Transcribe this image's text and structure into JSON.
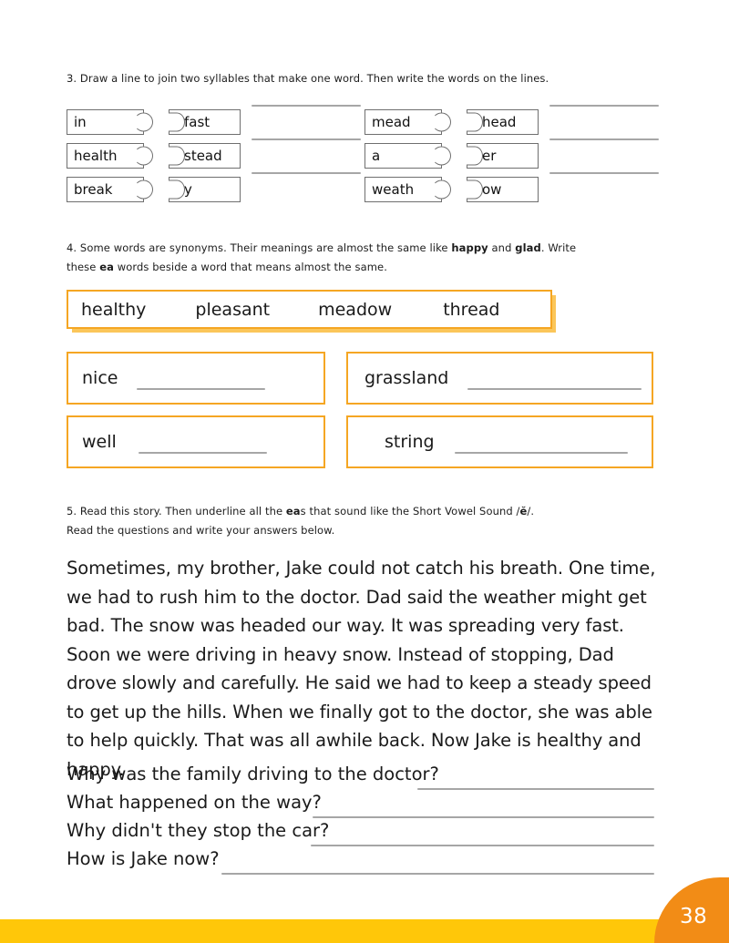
{
  "page": {
    "number": "38",
    "accent_orange": "#F5A623",
    "badge_orange": "#F28C16",
    "footer_yellow": "#FFC709",
    "line_gray": "#A6A6A6"
  },
  "q3": {
    "instruction_prefix": "3. Draw a line to join two syllables that make one word. Then write the words on the lines.",
    "rows": [
      {
        "left": "in",
        "right": "fast",
        "right2_left": "mead",
        "right2_right": "head"
      },
      {
        "left": "health",
        "right": "stead",
        "right2_left": "a",
        "right2_right": "er"
      },
      {
        "left": "break",
        "right": "y",
        "right2_left": "weath",
        "right2_right": "ow"
      }
    ]
  },
  "q4": {
    "instruction_line1_a": "4. Some words are synonyms. Their meanings are almost the same like ",
    "instruction_bold1": "happy",
    "instruction_line1_b": " and ",
    "instruction_bold2": "glad",
    "instruction_line1_c": ". Write",
    "instruction_line2_a": "these ",
    "instruction_bold3": "ea",
    "instruction_line2_b": " words beside a word that means almost the same.",
    "word_bank": [
      "healthy",
      "pleasant",
      "meadow",
      "thread"
    ],
    "answer_prompts": [
      "nice",
      "grassland",
      "well",
      "string"
    ]
  },
  "q5": {
    "instruction_line1_a": "5. Read this story. Then underline all the ",
    "instruction_bold1": "ea",
    "instruction_line1_b": "s that sound like the Short Vowel Sound /",
    "instruction_bold2": "ĕ",
    "instruction_line1_c": "/.",
    "instruction_line2": "Read the questions and write your answers below.",
    "story": "Sometimes, my brother, Jake could not catch his breath. One time, we had to rush him to the doctor. Dad said the weather might get bad. The snow was headed our way. It was spreading very fast. Soon we were driving in heavy snow. Instead of stopping, Dad drove slowly and carefully. He said we had to keep a steady speed to get up the hills. When we finally got to the doctor, she was able to help quickly. That was all awhile back. Now Jake is healthy and happy.",
    "questions": [
      "Why was the family driving to the doctor?",
      "What happened on the way?",
      "Why didn't they stop the car?",
      "How is Jake now?"
    ]
  }
}
